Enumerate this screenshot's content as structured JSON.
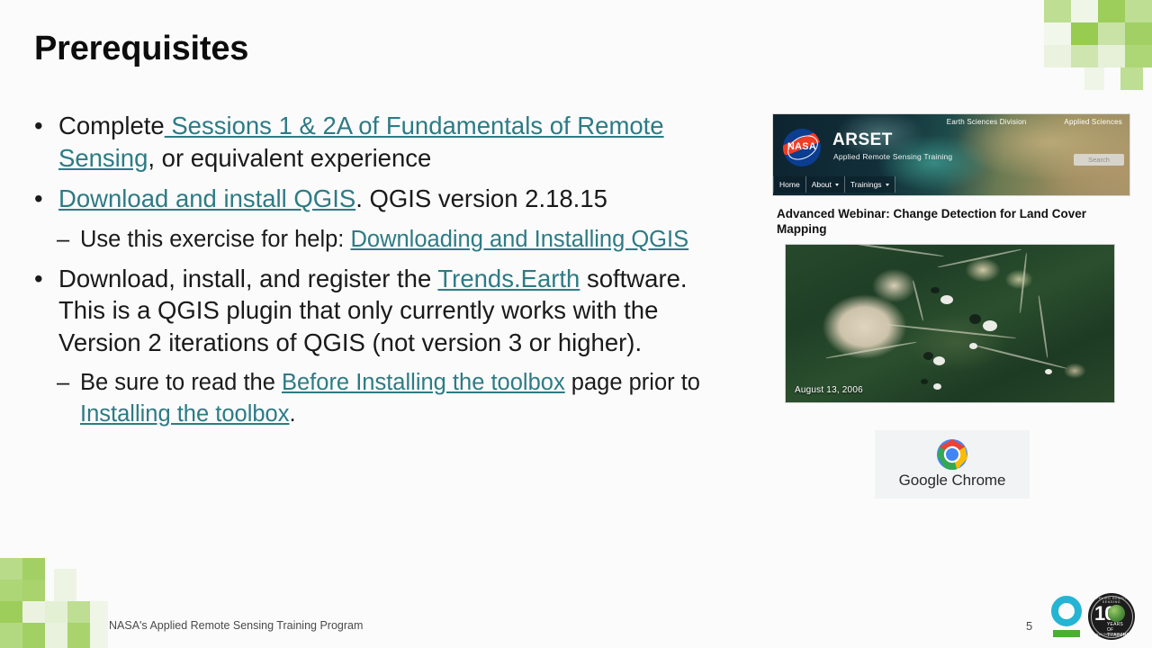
{
  "slide": {
    "title": "Prerequisites",
    "page_number": "5",
    "footer": "NASA's Applied Remote Sensing Training Program",
    "accent_link_color": "#2d7b85",
    "accent_green": "#8cc63e"
  },
  "bullets": {
    "b1": {
      "marker": "•",
      "pre": "Complete",
      "link": " Sessions 1 & 2A of Fundamentals of Remote Sensing",
      "post": ", or equivalent experience"
    },
    "b2": {
      "marker": "•",
      "link": "Download and install QGIS",
      "post": ". QGIS version 2.18.15"
    },
    "b2a": {
      "marker": "–",
      "pre": "Use this exercise for help: ",
      "link": "Downloading and Installing QGIS"
    },
    "b3": {
      "marker": "•",
      "pre": "Download, install, and register the ",
      "link": "Trends.Earth",
      "post": " software. This is a QGIS plugin that only currently works with the Version 2 iterations of QGIS (not version 3 or higher)."
    },
    "b3a": {
      "marker": "–",
      "pre": "Be sure to read the ",
      "link1": "Before Installing the toolbox",
      "mid": " page prior to ",
      "link2": "Installing the toolbox",
      "post": "."
    }
  },
  "arset_site": {
    "brand": "ARSET",
    "tagline": "Applied Remote Sensing Training",
    "nasa_wordmark": "NASA",
    "top_links": [
      "Earth Sciences Division",
      "Applied Sciences"
    ],
    "search_placeholder": "Search",
    "nav": [
      {
        "label": "Home",
        "has_caret": false
      },
      {
        "label": "About",
        "has_caret": true
      },
      {
        "label": "Trainings",
        "has_caret": true
      }
    ]
  },
  "webinar": {
    "title": "Advanced Webinar: Change Detection for Land Cover Mapping",
    "image_date_caption": "August 13, 2006"
  },
  "chrome": {
    "label": "Google Chrome",
    "colors": {
      "red": "#ea4335",
      "yellow": "#fbbc05",
      "green": "#34a853",
      "blue": "#4285f4"
    }
  },
  "badge": {
    "number": "10",
    "years_line1": "YEARS",
    "years_line2": "OF TRAINING",
    "arc_top": "APPLIED REMOTE SENSING",
    "arc_bottom": "TRAINING PROGRAM"
  }
}
